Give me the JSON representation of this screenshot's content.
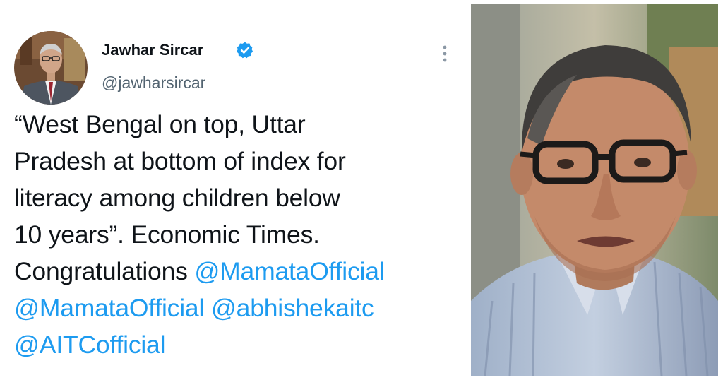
{
  "tweet": {
    "author_name": "Jawhar Sircar",
    "handle": "@jawharsircar",
    "verified": true,
    "text_lines": [
      "“West Bengal on top, Uttar",
      "Pradesh at bottom of index for",
      "literacy among children below",
      "10 years”. Economic Times."
    ],
    "congrats_prefix": "Congratulations ",
    "mentions": [
      "@MamataOfficial",
      "@MamataOfficial",
      "@abhishekaitc",
      "@AITCofficial"
    ]
  },
  "icons": {
    "verified": "verified-badge-icon",
    "more": "more-options-icon"
  },
  "colors": {
    "link": "#1d9bf0",
    "text": "#0f1419",
    "secondary": "#536471"
  }
}
